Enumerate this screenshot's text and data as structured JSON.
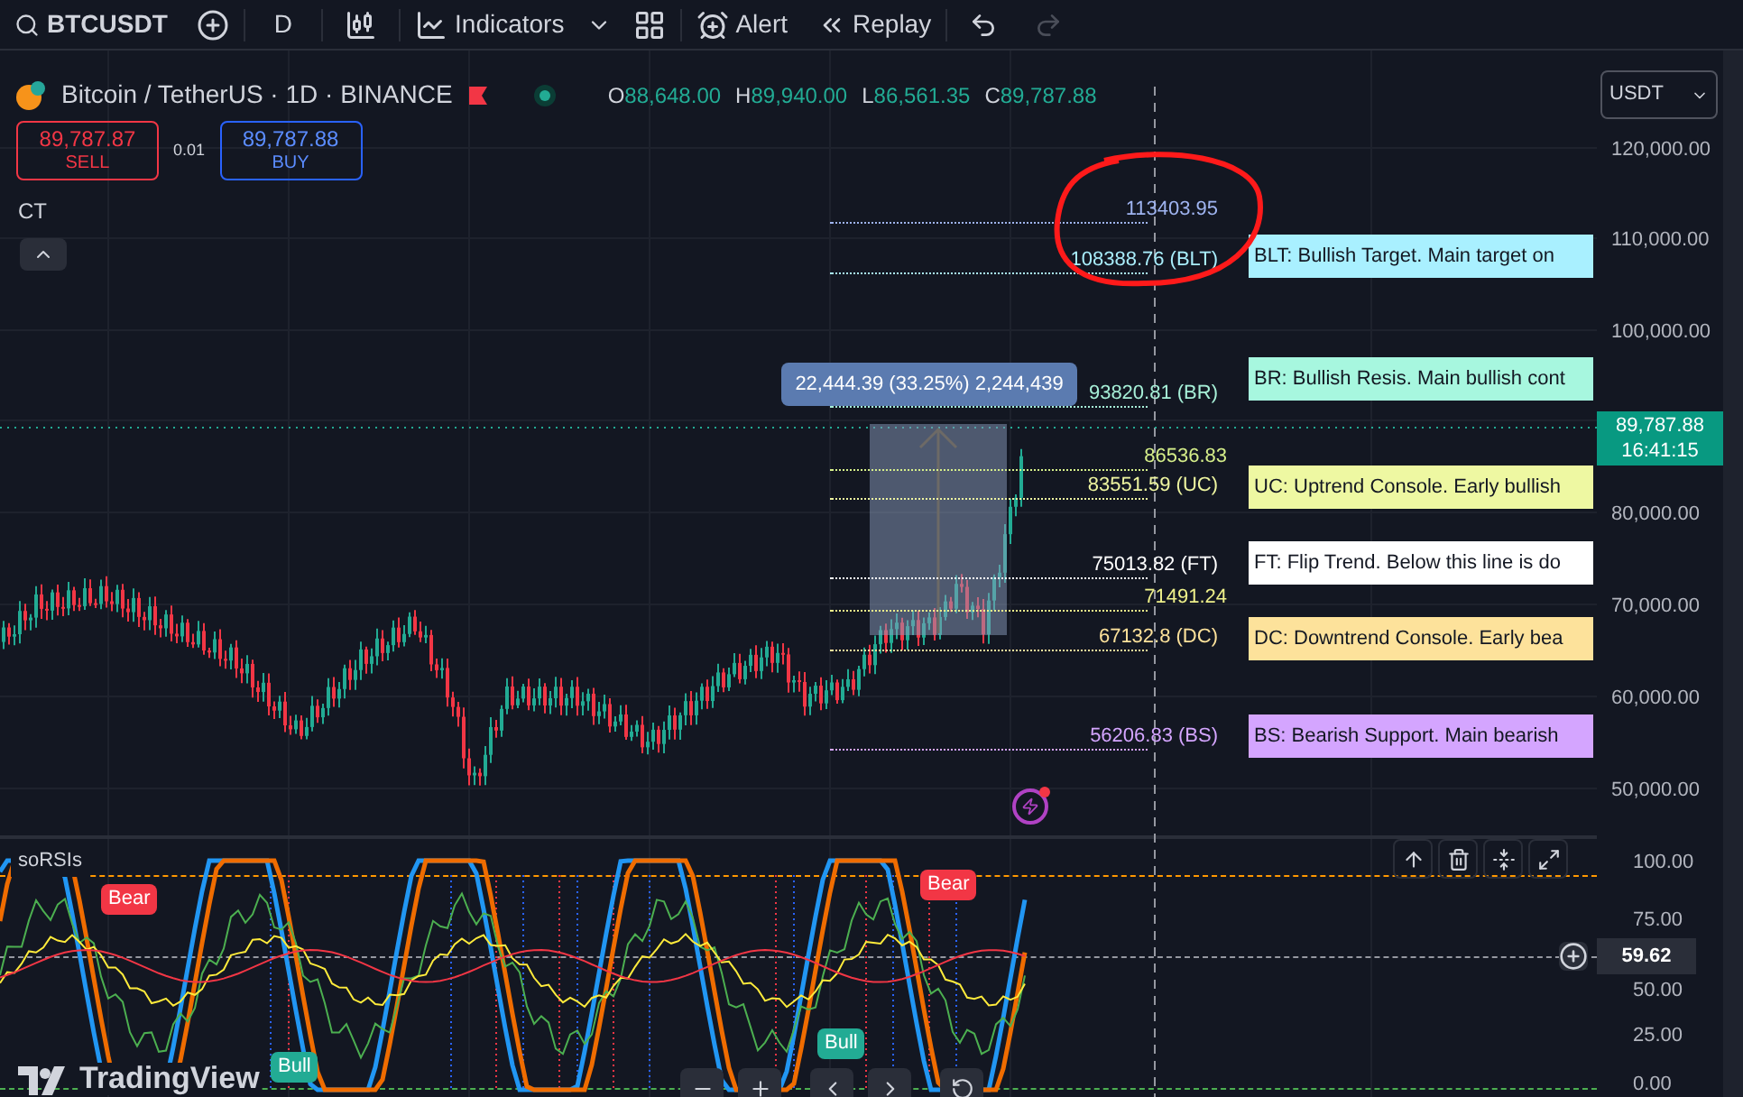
{
  "toolbar": {
    "symbol": "BTCUSDT",
    "interval": "D",
    "indicators": "Indicators",
    "alert": "Alert",
    "replay": "Replay",
    "undo": {
      "disabled": false
    },
    "redo": {
      "disabled": true
    }
  },
  "legend": {
    "title": "Bitcoin / TetherUS · 1D · BINANCE",
    "ohlc": [
      {
        "label": "O",
        "value": "88,648.00"
      },
      {
        "label": "H",
        "value": "89,940.00"
      },
      {
        "label": "L",
        "value": "86,561.35"
      },
      {
        "label": "C",
        "value": "89,787.88"
      }
    ],
    "currency": "USDT"
  },
  "trade": {
    "sell": {
      "price": "89,787.87",
      "label": "SELL"
    },
    "spread": "0.01",
    "buy": {
      "price": "89,787.88",
      "label": "BUY"
    }
  },
  "indicator_label": "CT",
  "levels": [
    {
      "text": "113403.95",
      "color": "#9fb4f0"
    },
    {
      "text": "108388.76 (BLT)",
      "color": "#a9eefc"
    },
    {
      "text": "93820.81 (BR)",
      "color": "#a7f0d8"
    },
    {
      "text": "86536.83",
      "color": "#d6ef8a"
    },
    {
      "text": "83551.59 (UC)",
      "color": "#eef5a0"
    },
    {
      "text": "75013.82 (FT)",
      "color": "#ffffff"
    },
    {
      "text": "71491.24",
      "color": "#eef08a"
    },
    {
      "text": "67132.8 (DC)",
      "color": "#fde29b"
    },
    {
      "text": "56206.83 (BS)",
      "color": "#d4a5ff"
    }
  ],
  "callouts": [
    {
      "text": "BLT: Bullish Target. Main target on",
      "color": "#a9f0ff"
    },
    {
      "text": "BR: Bullish Resis. Main bullish cont",
      "color": "#a7f7df"
    },
    {
      "text": "UC: Uptrend Console. Early bullish",
      "color": "#eef8a2"
    },
    {
      "text": "FT: Flip Trend. Below this line is do",
      "color": "#ffffff"
    },
    {
      "text": "DC: Downtrend Console. Early bea",
      "color": "#fde29b"
    },
    {
      "text": "BS: Bearish Support. Main bearish",
      "color": "#d4a5ff"
    }
  ],
  "measure": "22,444.39 (33.25%) 2,244,439",
  "price_axis": [
    "120,000.00",
    "110,000.00",
    "100,000.00",
    "80,000.00",
    "70,000.00",
    "60,000.00",
    "50,000.00"
  ],
  "current_price": {
    "price": "89,787.88",
    "countdown": "16:41:15"
  },
  "oscillator": {
    "name": "soRSIs",
    "signals": [
      {
        "text": "Bear",
        "kind": "bear"
      },
      {
        "text": "Bear",
        "kind": "bear"
      },
      {
        "text": "Bull",
        "kind": "bull"
      },
      {
        "text": "Bull",
        "kind": "bull"
      }
    ],
    "axis": [
      "100.00",
      "75.00",
      "50.00",
      "25.00",
      "0.00"
    ],
    "current": "59.62"
  },
  "logo": "TradingView"
}
